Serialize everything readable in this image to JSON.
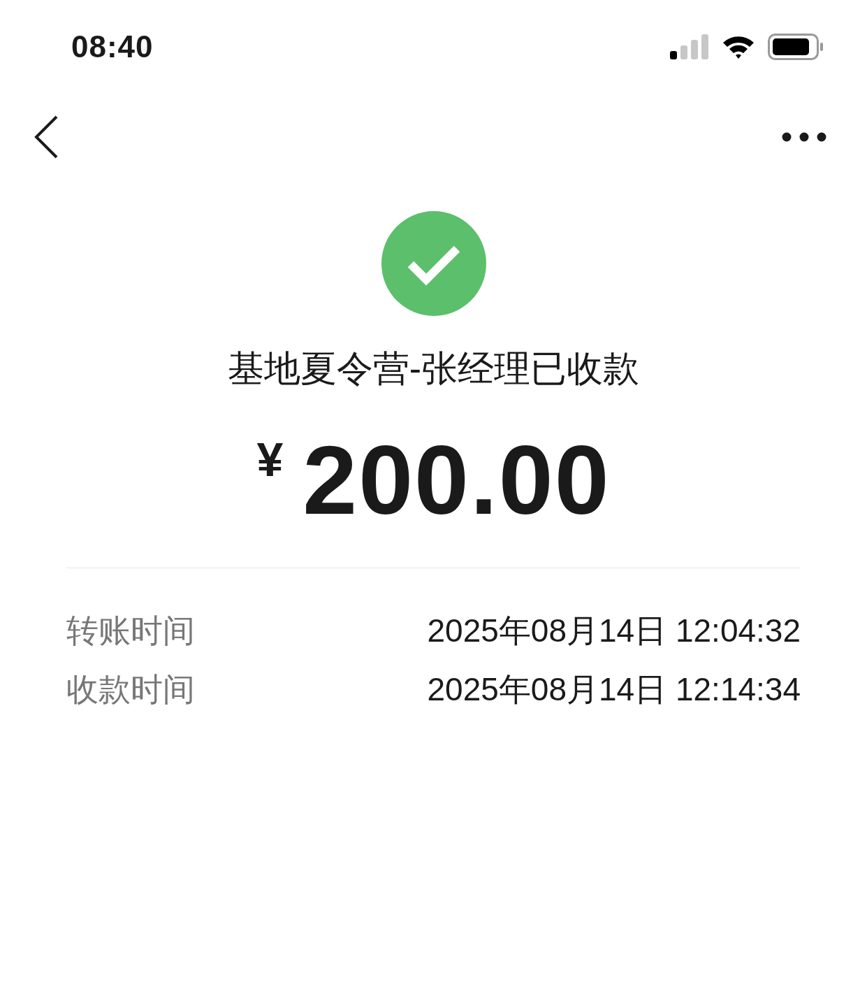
{
  "status_bar": {
    "time": "08:40"
  },
  "receipt": {
    "succeeded": true,
    "title": "基地夏令营-张经理已收款",
    "currency": "¥",
    "amount": "200.00"
  },
  "details": [
    {
      "label": "转账时间",
      "value": "2025年08月14日 12:04:32"
    },
    {
      "label": "收款时间",
      "value": "2025年08月14日 12:14:34"
    }
  ]
}
